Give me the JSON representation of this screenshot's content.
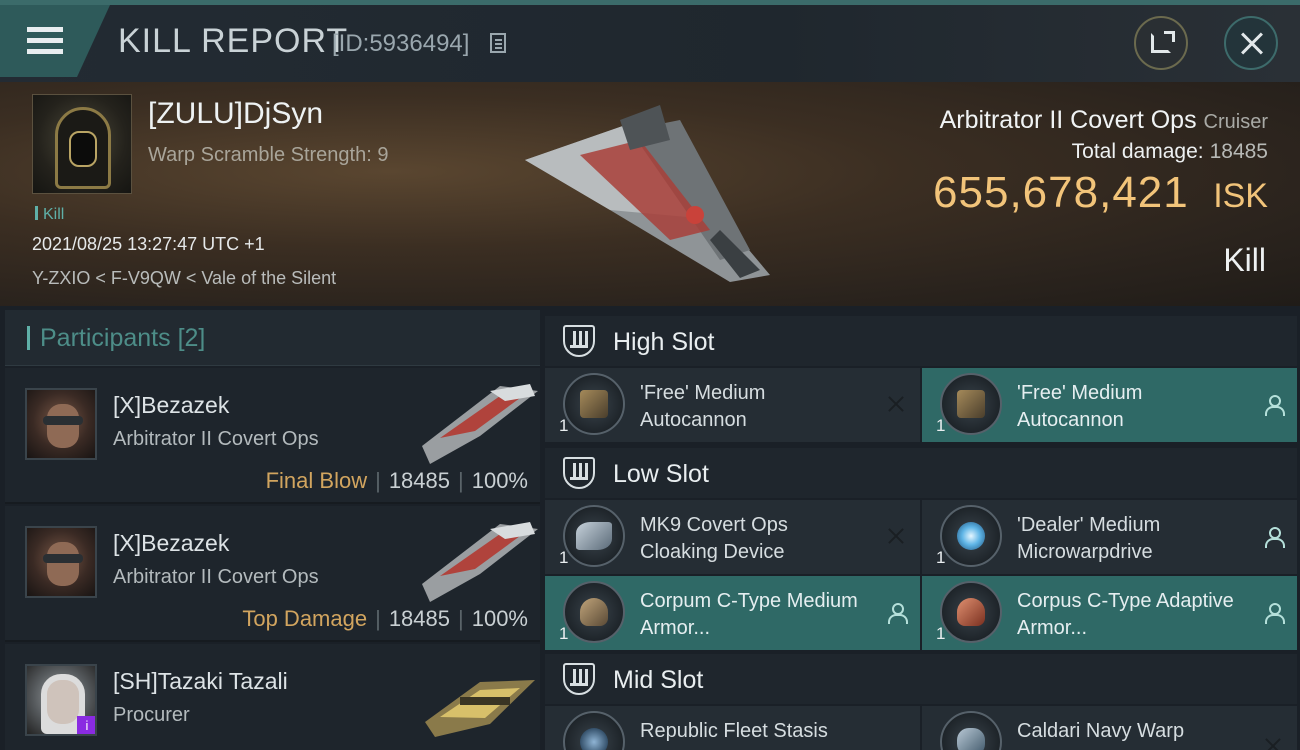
{
  "header": {
    "title": "KILL REPORT",
    "report_id": "[ID:5936494]"
  },
  "victim": {
    "name": "[ZULU]DjSyn",
    "subtitle": "Warp Scramble Strength: 9",
    "tag": "Kill",
    "timestamp": "2021/08/25 13:27:47 UTC +1",
    "location": "Y-ZXIO < F-V9QW < Vale of the Silent",
    "ship_name": "Arbitrator II Covert Ops",
    "ship_class": "Cruiser",
    "total_damage_label": "Total damage:",
    "total_damage": "18485",
    "isk_value": "655,678,421",
    "isk_unit": "ISK",
    "result": "Kill"
  },
  "participants": {
    "title": "Participants",
    "count": "[2]",
    "items": [
      {
        "name": "[X]Bezazek",
        "ship": "Arbitrator II Covert Ops",
        "role": "Final Blow",
        "damage": "18485",
        "percent": "100%"
      },
      {
        "name": "[X]Bezazek",
        "ship": "Arbitrator II Covert Ops",
        "role": "Top Damage",
        "damage": "18485",
        "percent": "100%"
      },
      {
        "name": "[SH]Tazaki Tazali",
        "ship": "Procurer",
        "badge": "i"
      }
    ]
  },
  "slots": {
    "high": {
      "title": "High Slot",
      "modules": [
        {
          "qty": "1",
          "name": "'Free' Medium Autocannon",
          "status": "destroyed"
        },
        {
          "qty": "1",
          "name": "'Free' Medium Autocannon",
          "status": "dropped"
        }
      ]
    },
    "low": {
      "title": "Low Slot",
      "modules": [
        {
          "qty": "1",
          "name": "MK9 Covert Ops Cloaking Device",
          "status": "destroyed"
        },
        {
          "qty": "1",
          "name": "'Dealer' Medium Microwarpdrive",
          "status": "dropped"
        },
        {
          "qty": "1",
          "name": "Corpum C-Type Medium Armor...",
          "status": "dropped"
        },
        {
          "qty": "1",
          "name": "Corpus C-Type Adaptive Armor...",
          "status": "dropped"
        }
      ]
    },
    "mid": {
      "title": "Mid Slot",
      "modules": [
        {
          "qty": "1",
          "name": "Republic Fleet Stasis",
          "status": "destroyed"
        },
        {
          "qty": "1",
          "name": "Caldari Navy Warp",
          "status": "destroyed"
        }
      ]
    }
  },
  "colors": {
    "accent_teal": "#2f6966",
    "isk_gold": "#f2c47a",
    "role_gold": "#d2a55f",
    "panel": "#252d34"
  }
}
